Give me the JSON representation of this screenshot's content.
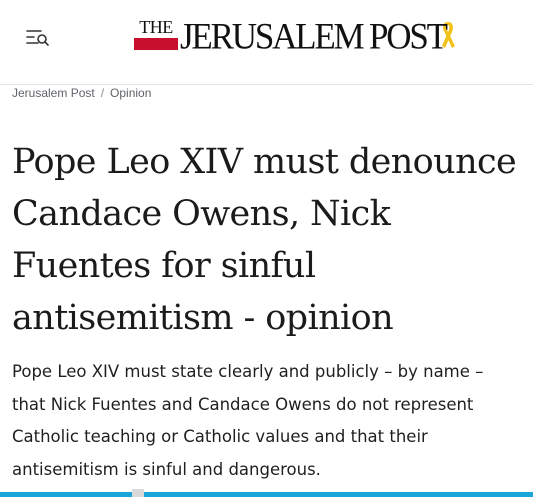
{
  "header": {
    "menu_icon": "menu-search-icon",
    "logo": {
      "the": "THE",
      "name": "JERUSALEM POST",
      "ribbon_icon": "yellow-ribbon-icon",
      "ribbon_color": "#f2c21a",
      "brand_red": "#c8102e"
    }
  },
  "breadcrumb": {
    "items": [
      {
        "label": "Jerusalem Post"
      },
      {
        "label": "Opinion"
      }
    ],
    "separator": "/"
  },
  "article": {
    "headline": "Pope Leo XIV must denounce Candace Owens, Nick Fuentes for sinful antisemitism - opinion",
    "subheadline": "Pope Leo XIV must state clearly and publicly – by name – that Nick Fuentes and Candace Owens do not represent Catholic teaching or Catholic values and that their antisemitism is sinful and dangerous."
  },
  "colors": {
    "accent_strip": "#1aa6d8"
  }
}
